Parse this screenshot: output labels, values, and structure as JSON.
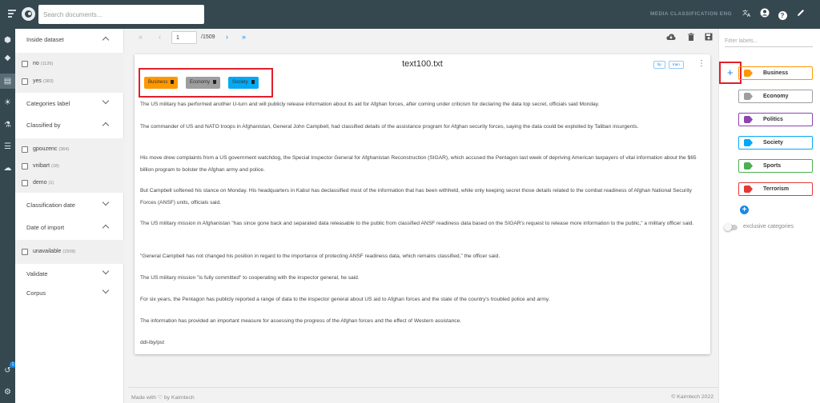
{
  "header": {
    "search_placeholder": "Search documents...",
    "project_name": "MEDIA CLASSIFICATION ENG",
    "icons": [
      "menu-icon",
      "logo",
      "translate-icon",
      "account-icon",
      "help-icon",
      "edit-icon"
    ]
  },
  "rail": {
    "icons": [
      "dataset-icon",
      "tag-icon",
      "document-icon",
      "bulb-icon",
      "flask-icon",
      "list-icon",
      "model-icon",
      "history-icon",
      "settings-icon"
    ],
    "history_badge": "1"
  },
  "filters": {
    "inside_dataset": {
      "label": "Inside dataset",
      "options": [
        {
          "label": "no",
          "count": "(1126)"
        },
        {
          "label": "yes",
          "count": "(383)"
        }
      ]
    },
    "categories_label": {
      "label": "Categories label"
    },
    "classified_by": {
      "label": "Classified by",
      "options": [
        {
          "label": "gpouzenc",
          "count": "(364)"
        },
        {
          "label": "vnibart",
          "count": "(18)"
        },
        {
          "label": "demo",
          "count": "(1)"
        }
      ]
    },
    "classification_date": {
      "label": "Classification date"
    },
    "date_of_import": {
      "label": "Date of import",
      "options": [
        {
          "label": "unavailable",
          "count": "(1509)"
        }
      ]
    },
    "validate": {
      "label": "Validate"
    },
    "corpus": {
      "label": "Corpus"
    }
  },
  "pagination": {
    "current_page": "1",
    "total": "/1509"
  },
  "document": {
    "title": "text100.txt",
    "fip_label": "fip",
    "train_label": "train",
    "labels": [
      {
        "name": "Business",
        "color": "#ff9800"
      },
      {
        "name": "Economy",
        "color": "#9e9e9e"
      },
      {
        "name": "Society",
        "color": "#03a9f4"
      }
    ],
    "paragraphs": [
      "The US military has performed another U-turn and will publicly release information about its aid for Afghan forces, after coming under criticism for declaring the data top secret, officials said Monday.",
      "The commander of US and NATO troops in Afghanistan, General John Campbell, had classified details of the assistance program for Afghan security forces, saying the data could be exploited by Taliban insurgents.",
      "His move drew complaints from a US government watchdog, the Special Inspector General for Afghanistan Reconstruction (SIGAR), which accused the Pentagon last week of depriving American taxpayers of vital information about the $65 billion program to bolster the Afghan army and police.",
      "But Campbell softened his stance on Monday. His headquarters in Kabul has declassified most of the information that has been withheld, while only keeping secret those details related to the combat readiness of Afghan National Security Forces (ANSF) units, officials said.",
      "The US military mission in Afghanistan \"has since gone back and separated data releasable to the public from classified ANSF readiness data based on the SIGAR's request to release more information to the public,\" a military officer said.",
      "\"General Campbell has not changed his position in regard to the importance of protecting ANSF readiness data, which remains classified,\" the officer said.",
      "The US military mission \"is fully committed\" to cooperating with the inspector general, he said.",
      "For six years, the Pentagon has publicly reported a range of data to the inspector general about US aid to Afghan forces and the state of the country's troubled police and army.",
      "The information has provided an important measure for assessing the progress of the Afghan forces and the effect of Western assistance.",
      "ddl-lby/pst"
    ]
  },
  "footer": {
    "left": "Made with ♡ by Kairntech",
    "right": "©  Kairntech 2022"
  },
  "labels_panel": {
    "filter_placeholder": "Filter labels...",
    "categories": [
      {
        "name": "Business",
        "color": "#ff9800"
      },
      {
        "name": "Economy",
        "color": "#9e9e9e"
      },
      {
        "name": "Politics",
        "color": "#8e44ad"
      },
      {
        "name": "Society",
        "color": "#03a9f4"
      },
      {
        "name": "Sports",
        "color": "#4caf50"
      },
      {
        "name": "Terrorism",
        "color": "#e53935"
      }
    ],
    "exclusive_label": "exclusive categories"
  }
}
